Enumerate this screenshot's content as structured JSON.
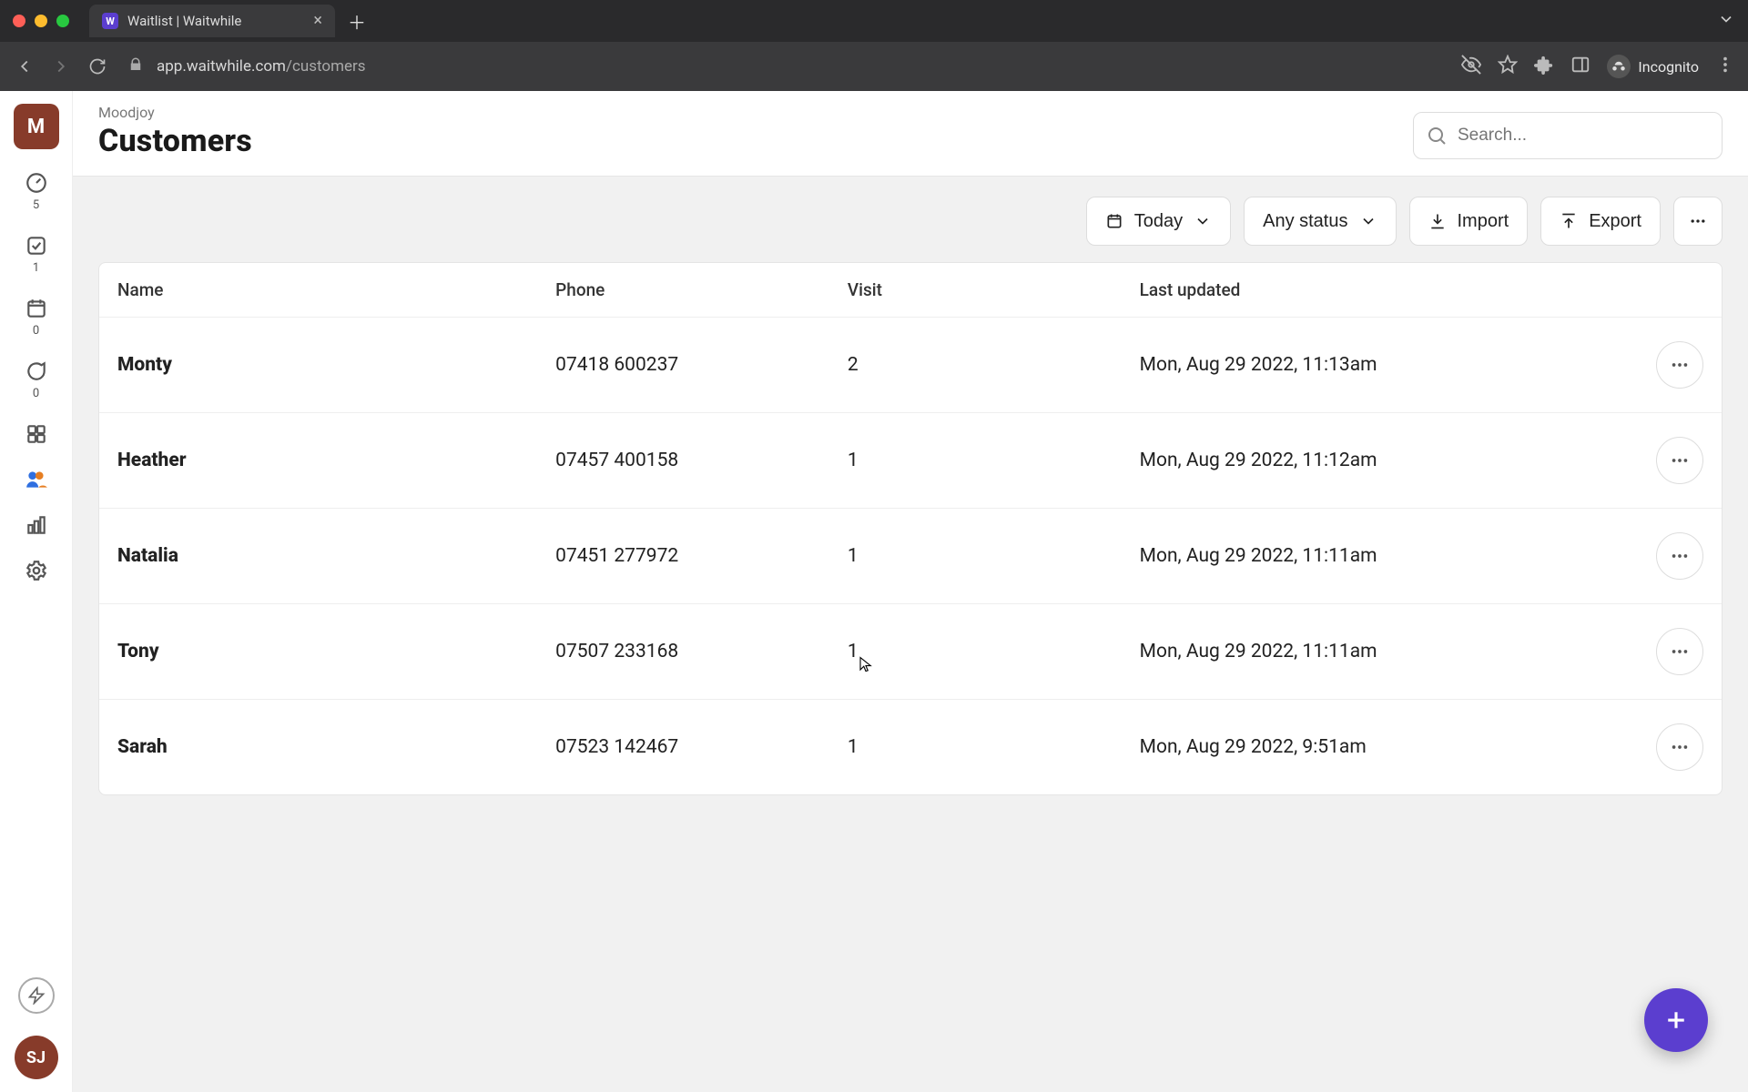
{
  "browser": {
    "tab_title": "Waitlist | Waitwhile",
    "favicon_letter": "W",
    "url_host": "app.waitwhile.com",
    "url_path": "/customers",
    "incognito_label": "Incognito"
  },
  "sidebar": {
    "org_initial": "M",
    "items": [
      {
        "id": "waitlist",
        "count": "5"
      },
      {
        "id": "bookings",
        "count": "1"
      },
      {
        "id": "calendar",
        "count": "0"
      },
      {
        "id": "messages",
        "count": "0"
      },
      {
        "id": "apps",
        "count": ""
      },
      {
        "id": "customers",
        "count": ""
      },
      {
        "id": "analytics",
        "count": ""
      },
      {
        "id": "settings",
        "count": ""
      }
    ],
    "user_initials": "SJ"
  },
  "header": {
    "breadcrumb": "Moodjoy",
    "title": "Customers",
    "search_placeholder": "Search..."
  },
  "toolbar": {
    "today_label": "Today",
    "status_label": "Any status",
    "import_label": "Import",
    "export_label": "Export"
  },
  "table": {
    "columns": {
      "name": "Name",
      "phone": "Phone",
      "visit": "Visit",
      "updated": "Last updated"
    },
    "rows": [
      {
        "name": "Monty",
        "phone": "07418 600237",
        "visit": "2",
        "updated": "Mon, Aug 29 2022, 11:13am"
      },
      {
        "name": "Heather",
        "phone": "07457 400158",
        "visit": "1",
        "updated": "Mon, Aug 29 2022, 11:12am"
      },
      {
        "name": "Natalia",
        "phone": "07451 277972",
        "visit": "1",
        "updated": "Mon, Aug 29 2022, 11:11am"
      },
      {
        "name": "Tony",
        "phone": "07507 233168",
        "visit": "1",
        "updated": "Mon, Aug 29 2022, 11:11am"
      },
      {
        "name": "Sarah",
        "phone": "07523 142467",
        "visit": "1",
        "updated": "Mon, Aug 29 2022, 9:51am"
      }
    ]
  },
  "colors": {
    "accent": "#5b3ecf",
    "org": "#873b2a"
  }
}
